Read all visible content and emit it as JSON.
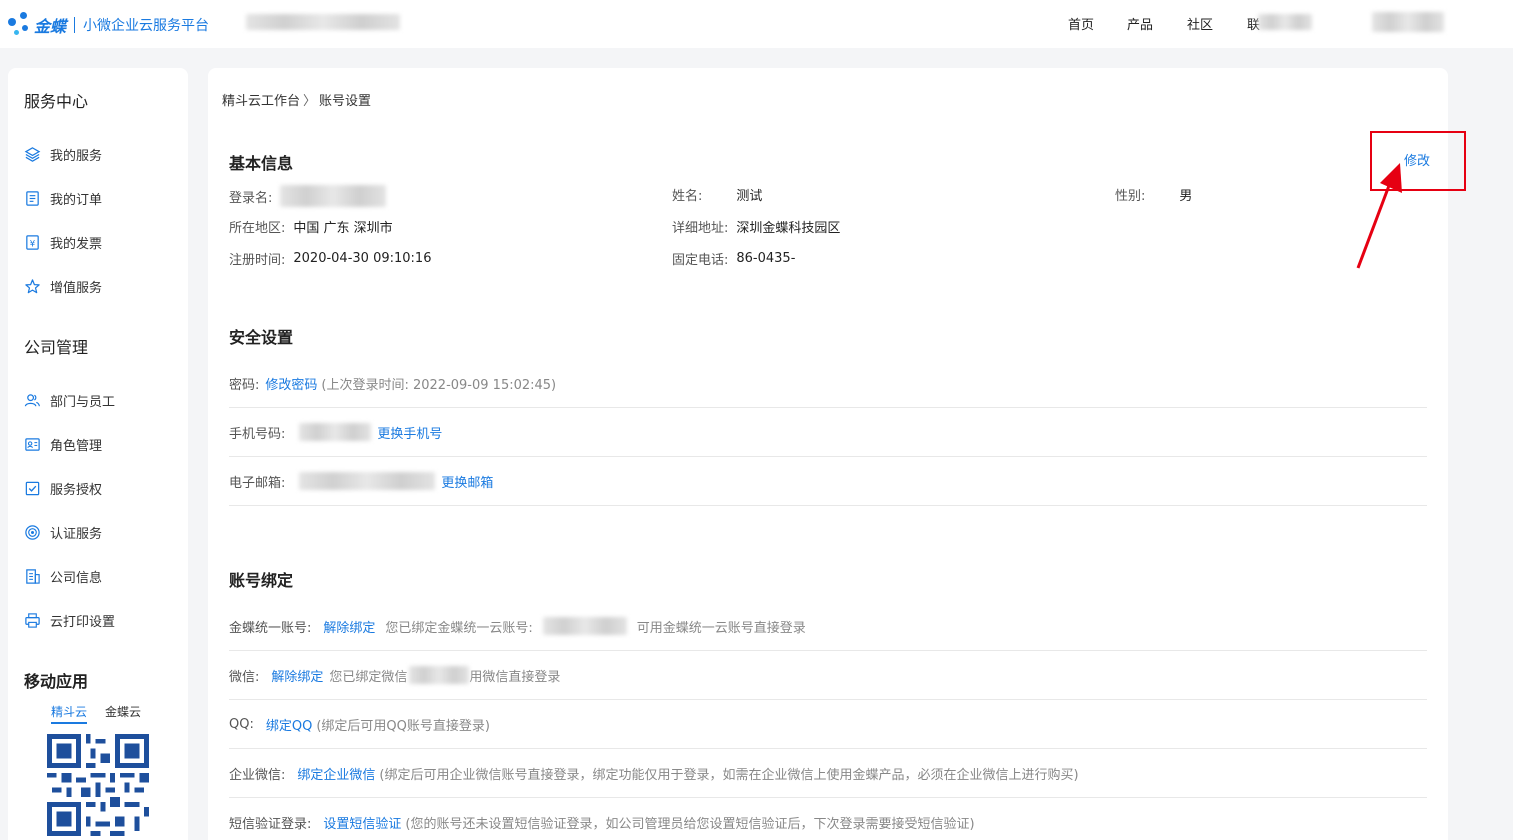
{
  "header": {
    "brand": "金蝶",
    "platform": "小微企业云服务平台",
    "nav": [
      "首页",
      "产品",
      "社区",
      "联"
    ]
  },
  "sidebar": {
    "service_center": "服务中心",
    "service_items": [
      "我的服务",
      "我的订单",
      "我的发票",
      "增值服务"
    ],
    "company_mgmt": "公司管理",
    "company_items": [
      "部门与员工",
      "角色管理",
      "服务授权",
      "认证服务",
      "公司信息",
      "云打印设置"
    ],
    "mobile_app": "移动应用",
    "tabs": [
      "精斗云",
      "金蝶云"
    ]
  },
  "breadcrumb": {
    "root": "精斗云工作台",
    "current": "账号设置"
  },
  "basic": {
    "title": "基本信息",
    "edit": "修改",
    "login_label": "登录名:",
    "name_label": "姓名:",
    "name_value": "测试",
    "gender_label": "性别:",
    "gender_value": "男",
    "region_label": "所在地区:",
    "region_value": "中国 广东 深圳市",
    "address_label": "详细地址:",
    "address_value": "深圳金蝶科技园区",
    "reg_label": "注册时间:",
    "reg_value": "2020-04-30 09:10:16",
    "phone_label": "固定电话:",
    "phone_value": "86-0435-"
  },
  "security": {
    "title": "安全设置",
    "password_label": "密码:",
    "password_link": "修改密码",
    "password_note": "(上次登录时间: 2022-09-09 15:02:45)",
    "mobile_label": "手机号码:",
    "mobile_link": "更换手机号",
    "email_label": "电子邮箱:",
    "email_link": "更换邮箱"
  },
  "binding": {
    "title": "账号绑定",
    "kingdee_label": "金蝶统一账号:",
    "kingdee_link": "解除绑定",
    "kingdee_note": "您已绑定金蝶统一云账号:",
    "kingdee_note2": "可用金蝶统一云账号直接登录",
    "wechat_label": "微信:",
    "wechat_link": "解除绑定",
    "wechat_note": "您已绑定微信",
    "wechat_note2": "用微信直接登录",
    "qq_label": "QQ:",
    "qq_link": "绑定QQ",
    "qq_note": "(绑定后可用QQ账号直接登录)",
    "wework_label": "企业微信:",
    "wework_link": "绑定企业微信",
    "wework_note": "(绑定后可用企业微信账号直接登录，绑定功能仅用于登录，如需在企业微信上使用金蝶产品，必须在企业微信上进行购买)",
    "sms_label": "短信验证登录:",
    "sms_link": "设置短信验证",
    "sms_note": "(您的账号还未设置短信验证登录，如公司管理员给您设置短信验证后，下次登录需要接受短信验证)"
  },
  "colors": {
    "accent": "#1a7ae0",
    "highlight": "#e60012"
  }
}
